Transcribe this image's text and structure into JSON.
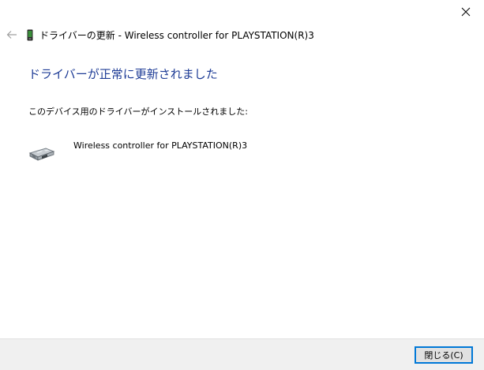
{
  "window": {
    "title": "ドライバーの更新 - Wireless controller for PLAYSTATION(R)3"
  },
  "icons": {
    "close": "close-icon",
    "back": "back-arrow-icon",
    "title": "device-manager-icon",
    "device": "gamepad-device-icon"
  },
  "main": {
    "heading": "ドライバーが正常に更新されました",
    "description": "このデバイス用のドライバーがインストールされました:",
    "device_name": "Wireless controller for PLAYSTATION(R)3"
  },
  "footer": {
    "close_button_label": "閉じる(C)"
  },
  "colors": {
    "heading": "#1e3c96",
    "button_border": "#0078d7",
    "footer_bg": "#f0f0f0"
  }
}
